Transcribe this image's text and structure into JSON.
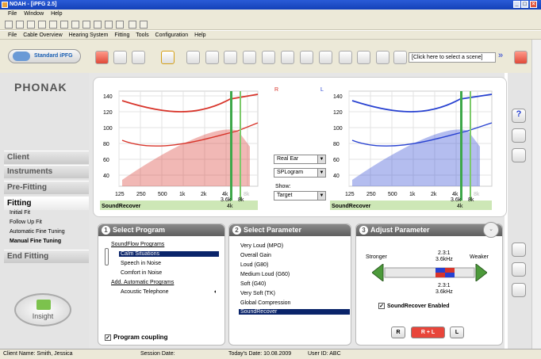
{
  "title_bar": {
    "title": "NOAH - [iPFG 2.5]"
  },
  "menu1": [
    "File",
    "Window",
    "Help"
  ],
  "menu2": [
    "File",
    "Cable Overview",
    "Hearing System",
    "Fitting",
    "Tools",
    "Configuration",
    "Help"
  ],
  "toolbar": {
    "program_button": "Standard iPFG",
    "scene_select": "[Click here to select a scene]"
  },
  "brand": {
    "logo": "PHONAK",
    "insight": "Insight"
  },
  "nav": {
    "items": [
      "Client",
      "Instruments",
      "Pre-Fitting",
      "Fitting",
      "End Fitting"
    ],
    "fitting_subitems": [
      "Initial Fit",
      "Follow Up Fit",
      "Automatic Fine Tuning",
      "Manual Fine Tuning"
    ]
  },
  "graph": {
    "right_ear_label": "R",
    "left_ear_label": "L",
    "y_ticks": [
      "140",
      "120",
      "100",
      "80",
      "60",
      "40"
    ],
    "x_ticks": [
      "125",
      "250",
      "500",
      "1k",
      "2k",
      "4k",
      "8k"
    ],
    "footer_label": "SoundRecover",
    "marker_label": "3.6k",
    "marker_label_2": "8k",
    "marker_label_3": "4k",
    "right_color": "#d8342a",
    "left_color": "#2741d1"
  },
  "mid_controls": {
    "view_select": "Real Ear",
    "type_select": "SPLogram",
    "show_label": "Show:",
    "show_select": "Target"
  },
  "panel1": {
    "title": "Select Program",
    "num": "1",
    "group1": "SoundFlow Programs",
    "programs": [
      "Calm Situations",
      "Speech in Noise",
      "Comfort in Noise"
    ],
    "group2": "Add. Automatic Programs",
    "program4": "Acoustic Telephone",
    "coupling": "Program coupling"
  },
  "panel2": {
    "title": "Select Parameter",
    "num": "2",
    "params": [
      "Very Loud (MPO)",
      "Overall Gain",
      "Loud (G80)",
      "Medium Loud (G60)",
      "Soft (G40)",
      "Very Soft (TK)",
      "Global Compression",
      "SoundRecover"
    ]
  },
  "panel3": {
    "title": "Adjust Parameter",
    "num": "3",
    "stronger": "Stronger",
    "weaker": "Weaker",
    "ratio_top": "2.3:1",
    "freq_top": "3.6kHz",
    "ratio_bottom": "2.3:1",
    "freq_bottom": "3.6kHz",
    "enabled_label": "SoundRecover Enabled",
    "buttons": [
      "R",
      "R + L",
      "L"
    ]
  },
  "status": {
    "client": "Client Name: Smith, Jessica",
    "session": "Session Date:",
    "today": "Today's Date: 10.08.2009",
    "user": "User ID: ABC"
  }
}
